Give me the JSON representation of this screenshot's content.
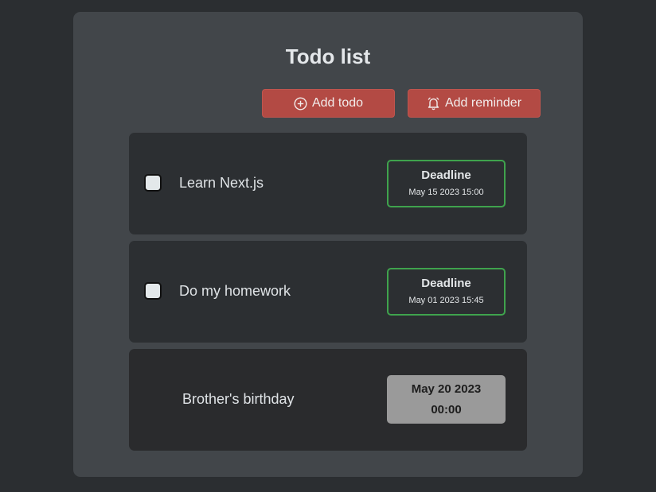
{
  "title": "Todo list",
  "toolbar": {
    "add_todo_label": "Add todo",
    "add_todo_icon": "plus-circle-icon",
    "add_reminder_label": "Add reminder",
    "add_reminder_icon": "alarm-bell-icon"
  },
  "todos": [
    {
      "text": "Learn Next.js",
      "checked": false,
      "deadline_label": "Deadline",
      "deadline": "May 15 2023 15:00"
    },
    {
      "text": "Do my homework",
      "checked": false,
      "deadline_label": "Deadline",
      "deadline": "May 01 2023 15:45"
    }
  ],
  "reminders": [
    {
      "text": "Brother's birthday",
      "date": "May 20 2023",
      "time": "00:00"
    }
  ],
  "colors": {
    "background": "#2b2e31",
    "panel": "#42464a",
    "button": "#b34a44",
    "deadline_border": "#3fa34d",
    "reminder_date_bg": "#9a9a9a"
  }
}
